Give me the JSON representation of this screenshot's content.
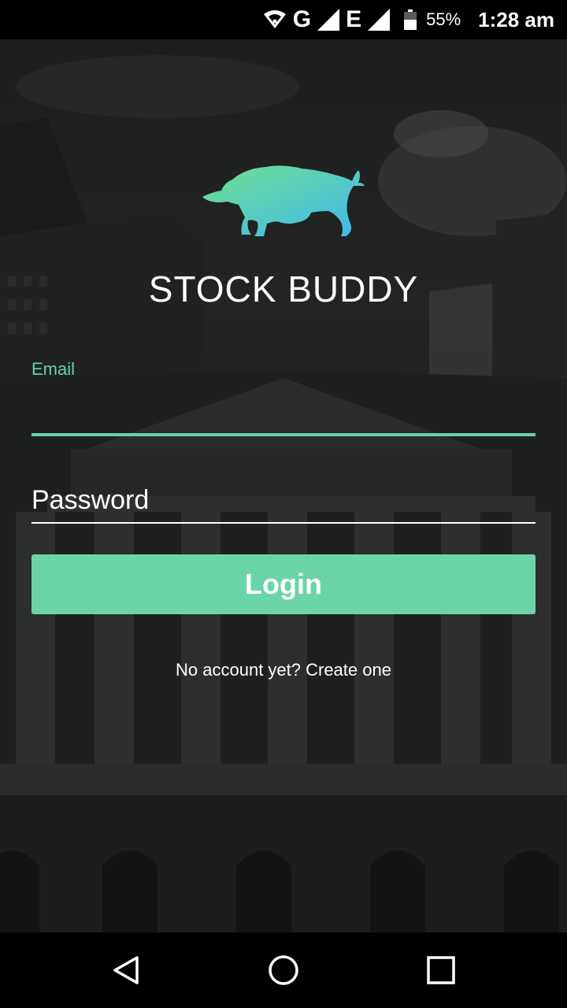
{
  "status_bar": {
    "network_g": "G",
    "network_e": "E",
    "battery_percent": "55%",
    "battery_level": 0.55,
    "time": "1:28 am"
  },
  "app": {
    "title": "STOCK BUDDY",
    "logo_icon": "bull-icon"
  },
  "form": {
    "email_label": "Email",
    "email_value": "",
    "password_placeholder": "Password",
    "login_label": "Login",
    "create_account_text": "No account yet? Create one"
  },
  "colors": {
    "accent": "#6bd4a8",
    "logo_gradient_start": "#6fe08f",
    "logo_gradient_end": "#3fb8f0"
  },
  "nav_bar": {
    "back_icon": "back-triangle-icon",
    "home_icon": "home-circle-icon",
    "recents_icon": "recents-square-icon"
  }
}
